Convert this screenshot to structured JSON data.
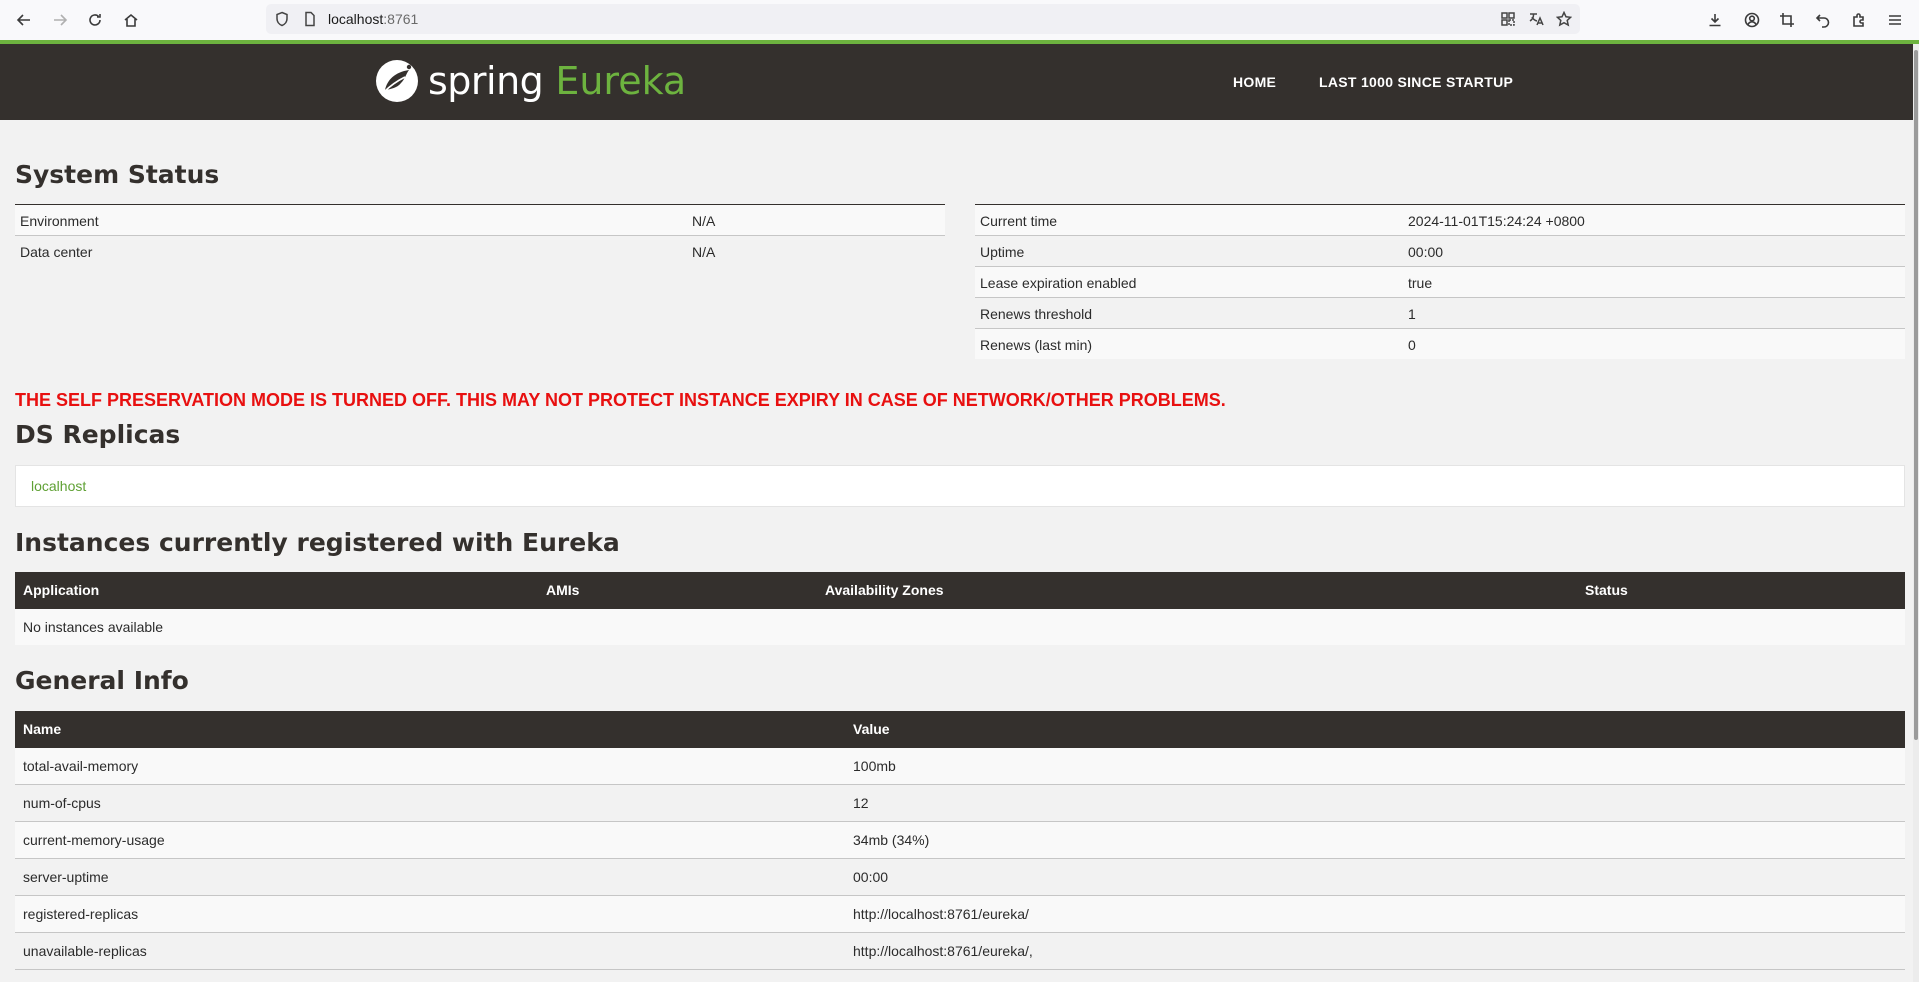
{
  "browser": {
    "url_host": "localhost",
    "url_port": ":8761",
    "icons": [
      "back-icon",
      "forward-icon",
      "reload-icon",
      "home-icon",
      "shield-icon",
      "page-icon",
      "qr-icon",
      "translate-icon",
      "star-icon",
      "download-icon",
      "account-icon",
      "crop-icon",
      "undo-icon",
      "extensions-icon",
      "menu-icon"
    ]
  },
  "header": {
    "logo_spring": "spring",
    "logo_eureka": "Eureka",
    "nav": [
      "HOME",
      "LAST 1000 SINCE STARTUP"
    ]
  },
  "system_status": {
    "title": "System Status",
    "left": [
      {
        "label": "Environment",
        "value": "N/A"
      },
      {
        "label": "Data center",
        "value": "N/A"
      }
    ],
    "right": [
      {
        "label": "Current time",
        "value": "2024-11-01T15:24:24 +0800"
      },
      {
        "label": "Uptime",
        "value": "00:00"
      },
      {
        "label": "Lease expiration enabled",
        "value": "true"
      },
      {
        "label": "Renews threshold",
        "value": "1"
      },
      {
        "label": "Renews (last min)",
        "value": "0"
      }
    ]
  },
  "warning": "THE SELF PRESERVATION MODE IS TURNED OFF. THIS MAY NOT PROTECT INSTANCE EXPIRY IN CASE OF NETWORK/OTHER PROBLEMS.",
  "ds_replicas": {
    "title": "DS Replicas",
    "link": "localhost"
  },
  "instances": {
    "title": "Instances currently registered with Eureka",
    "columns": [
      "Application",
      "AMIs",
      "Availability Zones",
      "Status"
    ],
    "empty_text": "No instances available"
  },
  "general_info": {
    "title": "General Info",
    "columns": [
      "Name",
      "Value"
    ],
    "rows": [
      {
        "name": "total-avail-memory",
        "value": "100mb"
      },
      {
        "name": "num-of-cpus",
        "value": "12"
      },
      {
        "name": "current-memory-usage",
        "value": "34mb (34%)"
      },
      {
        "name": "server-uptime",
        "value": "00:00"
      },
      {
        "name": "registered-replicas",
        "value": "http://localhost:8761/eureka/"
      },
      {
        "name": "unavailable-replicas",
        "value": "http://localhost:8761/eureka/,"
      }
    ]
  },
  "colors": {
    "header_bg": "#34302d",
    "brand_green": "#6db33f",
    "warning_red": "#e81010"
  }
}
